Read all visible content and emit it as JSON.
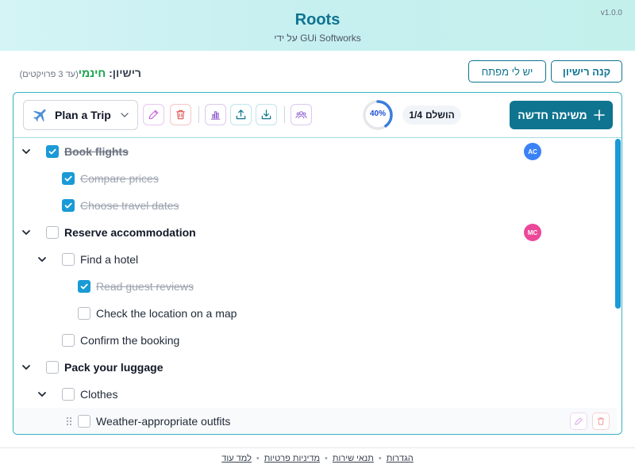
{
  "app": {
    "title": "Roots",
    "subtitle": "על ידי GUi Softworks",
    "version": "v1.0.0"
  },
  "license": {
    "buy_label": "קנה רישיון",
    "have_key_label": "יש לי מפתח",
    "label": "רישיון:",
    "value": "חינמי",
    "note": "(עד 3 פרויקטים)"
  },
  "toolbar": {
    "project_name": "Plan a Trip",
    "progress_percent": 40,
    "progress_label": "40%",
    "done_label": "הושלם",
    "done_count": "1/4",
    "new_task_label": "משימה חדשה"
  },
  "colors": {
    "accent": "#0e7490",
    "check": "#1a9ad6",
    "free": "#16a34a",
    "avatar_ac": "#3b82f6",
    "avatar_mc": "#ec4899"
  },
  "tasks": [
    {
      "text": "Book flights",
      "checked": true,
      "bold": true,
      "level": 0,
      "toggle": true,
      "avatar": "AC"
    },
    {
      "text": "Compare prices",
      "checked": true,
      "bold": false,
      "level": 1,
      "toggle": false
    },
    {
      "text": "Choose travel dates",
      "checked": true,
      "bold": false,
      "level": 1,
      "toggle": false
    },
    {
      "text": "Reserve accommodation",
      "checked": false,
      "bold": true,
      "level": 0,
      "toggle": true,
      "avatar": "MC"
    },
    {
      "text": "Find a hotel",
      "checked": false,
      "bold": false,
      "level": 1,
      "toggle": true
    },
    {
      "text": "Read guest reviews",
      "checked": true,
      "bold": false,
      "level": 2,
      "toggle": false
    },
    {
      "text": "Check the location on a map",
      "checked": false,
      "bold": false,
      "level": 2,
      "toggle": false
    },
    {
      "text": "Confirm the booking",
      "checked": false,
      "bold": false,
      "level": 1,
      "toggle": false
    },
    {
      "text": "Pack your luggage",
      "checked": false,
      "bold": true,
      "level": 0,
      "toggle": true
    },
    {
      "text": "Clothes",
      "checked": false,
      "bold": false,
      "level": 1,
      "toggle": true
    },
    {
      "text": "Weather-appropriate outfits",
      "checked": false,
      "bold": false,
      "level": 2,
      "toggle": false,
      "hover": true
    }
  ],
  "footer": {
    "settings": "הגדרות",
    "terms": "תנאי שירות",
    "privacy": "מדיניות פרטיות",
    "learn_more": "למד עוד"
  },
  "icons": {
    "project": "airplane-icon",
    "edit": "pencil-icon",
    "delete": "trash-icon",
    "stats": "bar-chart-icon",
    "export": "upload-icon",
    "import": "download-icon",
    "team": "users-icon",
    "add": "plus-icon"
  }
}
